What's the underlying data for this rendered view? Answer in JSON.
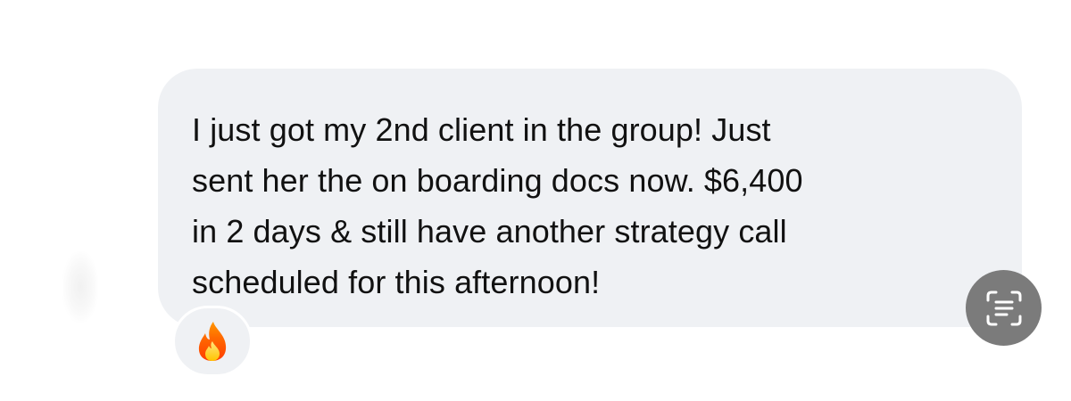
{
  "message": {
    "lines": [
      "I just got my 2nd client in the group! Just",
      "sent her the on boarding docs now. $6,400",
      "in 2 days & still have another strategy call",
      "scheduled for this afternoon!"
    ]
  },
  "reaction": {
    "icon": "fire-icon"
  },
  "scan_button": {
    "icon": "live-text-scan-icon"
  },
  "colors": {
    "bubble": "#eff1f4",
    "text": "#111111",
    "scan_button": "#7b7b7b"
  }
}
